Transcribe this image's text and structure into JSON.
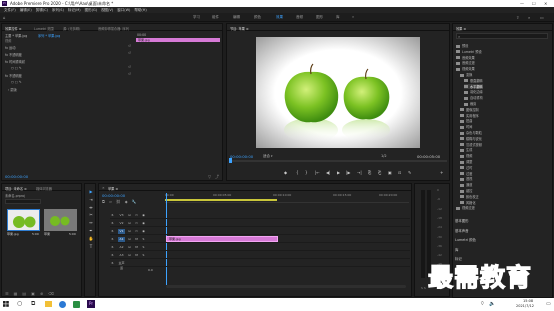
{
  "window": {
    "title": "Adobe Premiere Pro 2020 - C:\\用户\\Aao\\桌面\\未命名 *",
    "controls": [
      "—",
      "☐",
      "✕"
    ]
  },
  "menu": [
    "文件(F)",
    "编辑(E)",
    "剪辑(C)",
    "序列(S)",
    "标记(M)",
    "图形(G)",
    "视图(V)",
    "窗口(W)",
    "帮助(H)"
  ],
  "workspaces": [
    "学习",
    "组件",
    "编辑",
    "颜色",
    "效果",
    "音频",
    "图形",
    "库"
  ],
  "workspaces_more": "»",
  "active_workspace": "效果",
  "source_tabs": [
    "效果控件 ≡",
    "Lumetri 范围",
    "源: (无剪辑)",
    "音频剪辑混合器: 序列"
  ],
  "effect_controls": {
    "master_label": "主要 * 苹果.jpg",
    "sequence_label": "序列 * 苹果.jpg",
    "mini_time": "00:00",
    "clip_label": "苹果.jpg",
    "video_header": "视频",
    "rows": [
      "fx 运动",
      "fx 不透明度",
      "fx 时间重映射"
    ],
    "mask_row": "○ □ ✎",
    "sub_rows": [
      "fx 不透明度",
      "○ □ ✎",
      "› 蒙版"
    ],
    "timecode": "00:00:00:00"
  },
  "program": {
    "tab": "节目: 苹果 ≡",
    "timecode_left": "00:00:00:00",
    "fit_label": "适合",
    "ratio": "1/2",
    "timecode_right": "00:00:05:00"
  },
  "transport": [
    "◆",
    "{",
    "}",
    "|←",
    "◀|",
    "▶",
    "|▶",
    "→|",
    "⎘",
    "⎗",
    "▣",
    "⊡",
    "✎",
    "+"
  ],
  "effects_panel": {
    "tab": "效果 ≡",
    "search_placeholder": "",
    "tree": [
      "预设",
      "Lumetri 预设",
      "音频效果",
      "音频过渡",
      "视频效果",
      "变换",
      "垂直翻转",
      "水平翻转",
      "羽化边缘",
      "自动重构",
      "裁剪",
      "图像控制",
      "实用程序",
      "扭曲",
      "时间",
      "杂色与颗粒",
      "模糊与锐化",
      "沉浸式视频",
      "生成",
      "视频",
      "调整",
      "过时",
      "过渡",
      "透视",
      "通道",
      "键控",
      "颜色校正",
      "风格化",
      "视频过渡"
    ],
    "bottom_items": [
      "基本图形",
      "基本声音",
      "Lumetri 颜色",
      "库",
      "标记",
      "历史记录",
      "信息"
    ]
  },
  "project": {
    "tabs": [
      "项目: 未命名 ≡",
      "媒体浏览器"
    ],
    "file": "未命名.prproj",
    "items": [
      "苹果.jpg",
      "苹果"
    ],
    "durations": [
      "5:00",
      "5:00"
    ]
  },
  "timeline": {
    "tab": "苹果 ≡",
    "timecode": "00:00:00:00",
    "ruler": [
      "00:00",
      "00:00:05:00",
      "00:00:10:00",
      "00:00:15:00",
      "00:00:20:00"
    ],
    "tracks": [
      "V3",
      "V2",
      "V1",
      "A1",
      "A2",
      "A3",
      "主声道"
    ],
    "master_value": "0.0",
    "clip_label": "苹果.jpg"
  },
  "audio_meter": {
    "scale": [
      "0",
      "-6",
      "-12",
      "-18",
      "-24",
      "-30",
      "-36",
      "-42",
      "-48",
      "-54"
    ],
    "unit": "dB",
    "channels": "S S"
  },
  "taskbar": {
    "time": "15:08",
    "date": "2021/7/12"
  },
  "watermark": "最需教育"
}
